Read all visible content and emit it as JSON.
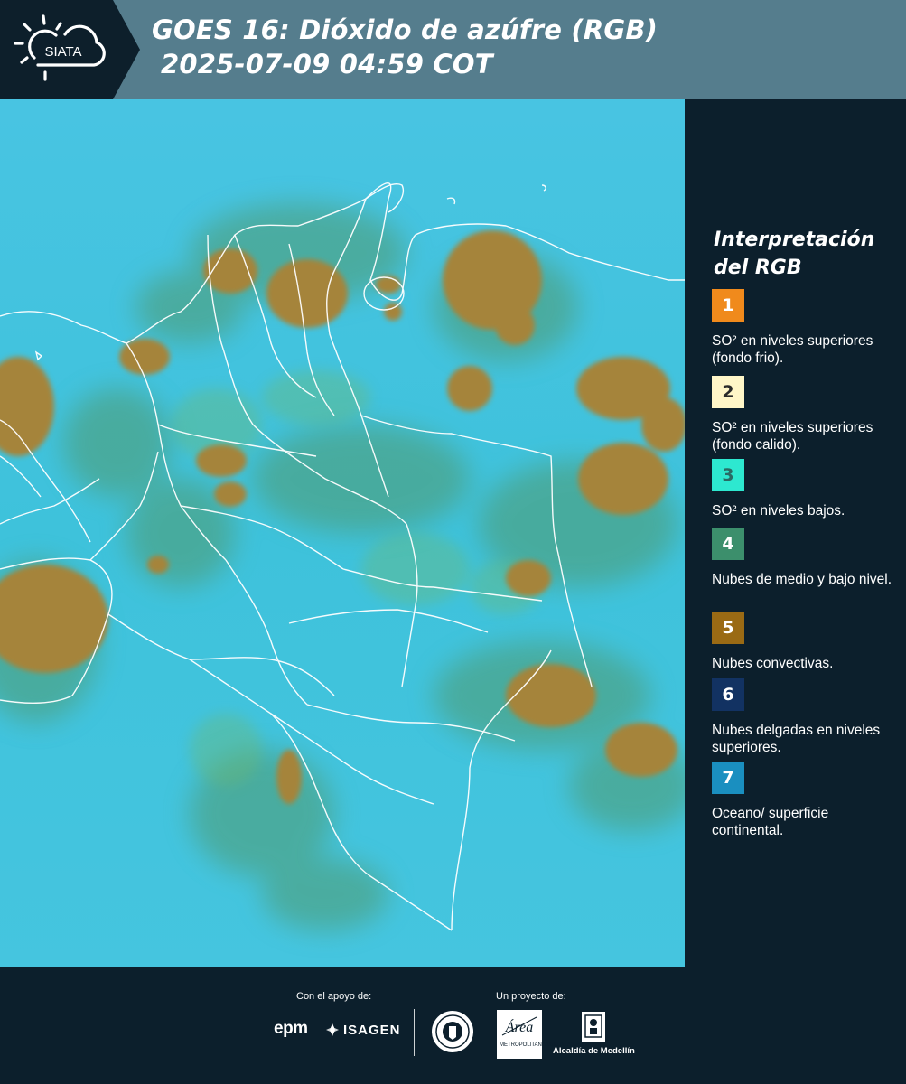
{
  "header": {
    "title_line1": "GOES 16: Dióxido de azúfre (RGB)",
    "title_line2": "2025-07-09 04:59 COT",
    "logo_text": "SIATA"
  },
  "legend": {
    "title": "Interpretación del RGB",
    "items": [
      {
        "number": "1",
        "color": "#f08a1c",
        "text_color": "#ffffff",
        "label": "SO² en niveles superiores (fondo frio)."
      },
      {
        "number": "2",
        "color": "#fff6c8",
        "text_color": "#2a2a2a",
        "label": "SO² en niveles superiores (fondo calido)."
      },
      {
        "number": "3",
        "color": "#2de8d0",
        "text_color": "#2a6a64",
        "label": "SO² en niveles bajos."
      },
      {
        "number": "4",
        "color": "#3c8f6c",
        "text_color": "#ffffff",
        "label": "Nubes de medio y bajo nivel."
      },
      {
        "number": "5",
        "color": "#9a6a14",
        "text_color": "#ffffff",
        "label": "Nubes convectivas."
      },
      {
        "number": "6",
        "color": "#123262",
        "text_color": "#ffffff",
        "label": "Nubes delgadas en niveles superiores."
      },
      {
        "number": "7",
        "color": "#1a8fc0",
        "text_color": "#ffffff",
        "label": "Oceano/ superficie continental."
      }
    ]
  },
  "footer": {
    "support_label": "Con el apoyo de:",
    "project_label": "Un proyecto de:",
    "sponsors": [
      "epm",
      "ISAGEN"
    ],
    "partners": [
      "Área Metropolitana Valle de Aburrá",
      "Alcaldía de Medellín"
    ],
    "area_text": "METROPOLITANA Valle de Aburrá",
    "alcaldia_text": "Alcaldía de Medellín"
  },
  "colors": {
    "header_bg": "#557d8d",
    "dark_bg": "#0c1f2c",
    "map_cyan": "#3cc4dd",
    "cloud_convective": "#a08030",
    "cloud_low": "#5a9a64",
    "borders": "#ffffff"
  },
  "icons": [
    "sun-cloud-icon",
    "isagen-icon",
    "seal-icon",
    "area-logo-icon",
    "alcaldia-icon"
  ]
}
